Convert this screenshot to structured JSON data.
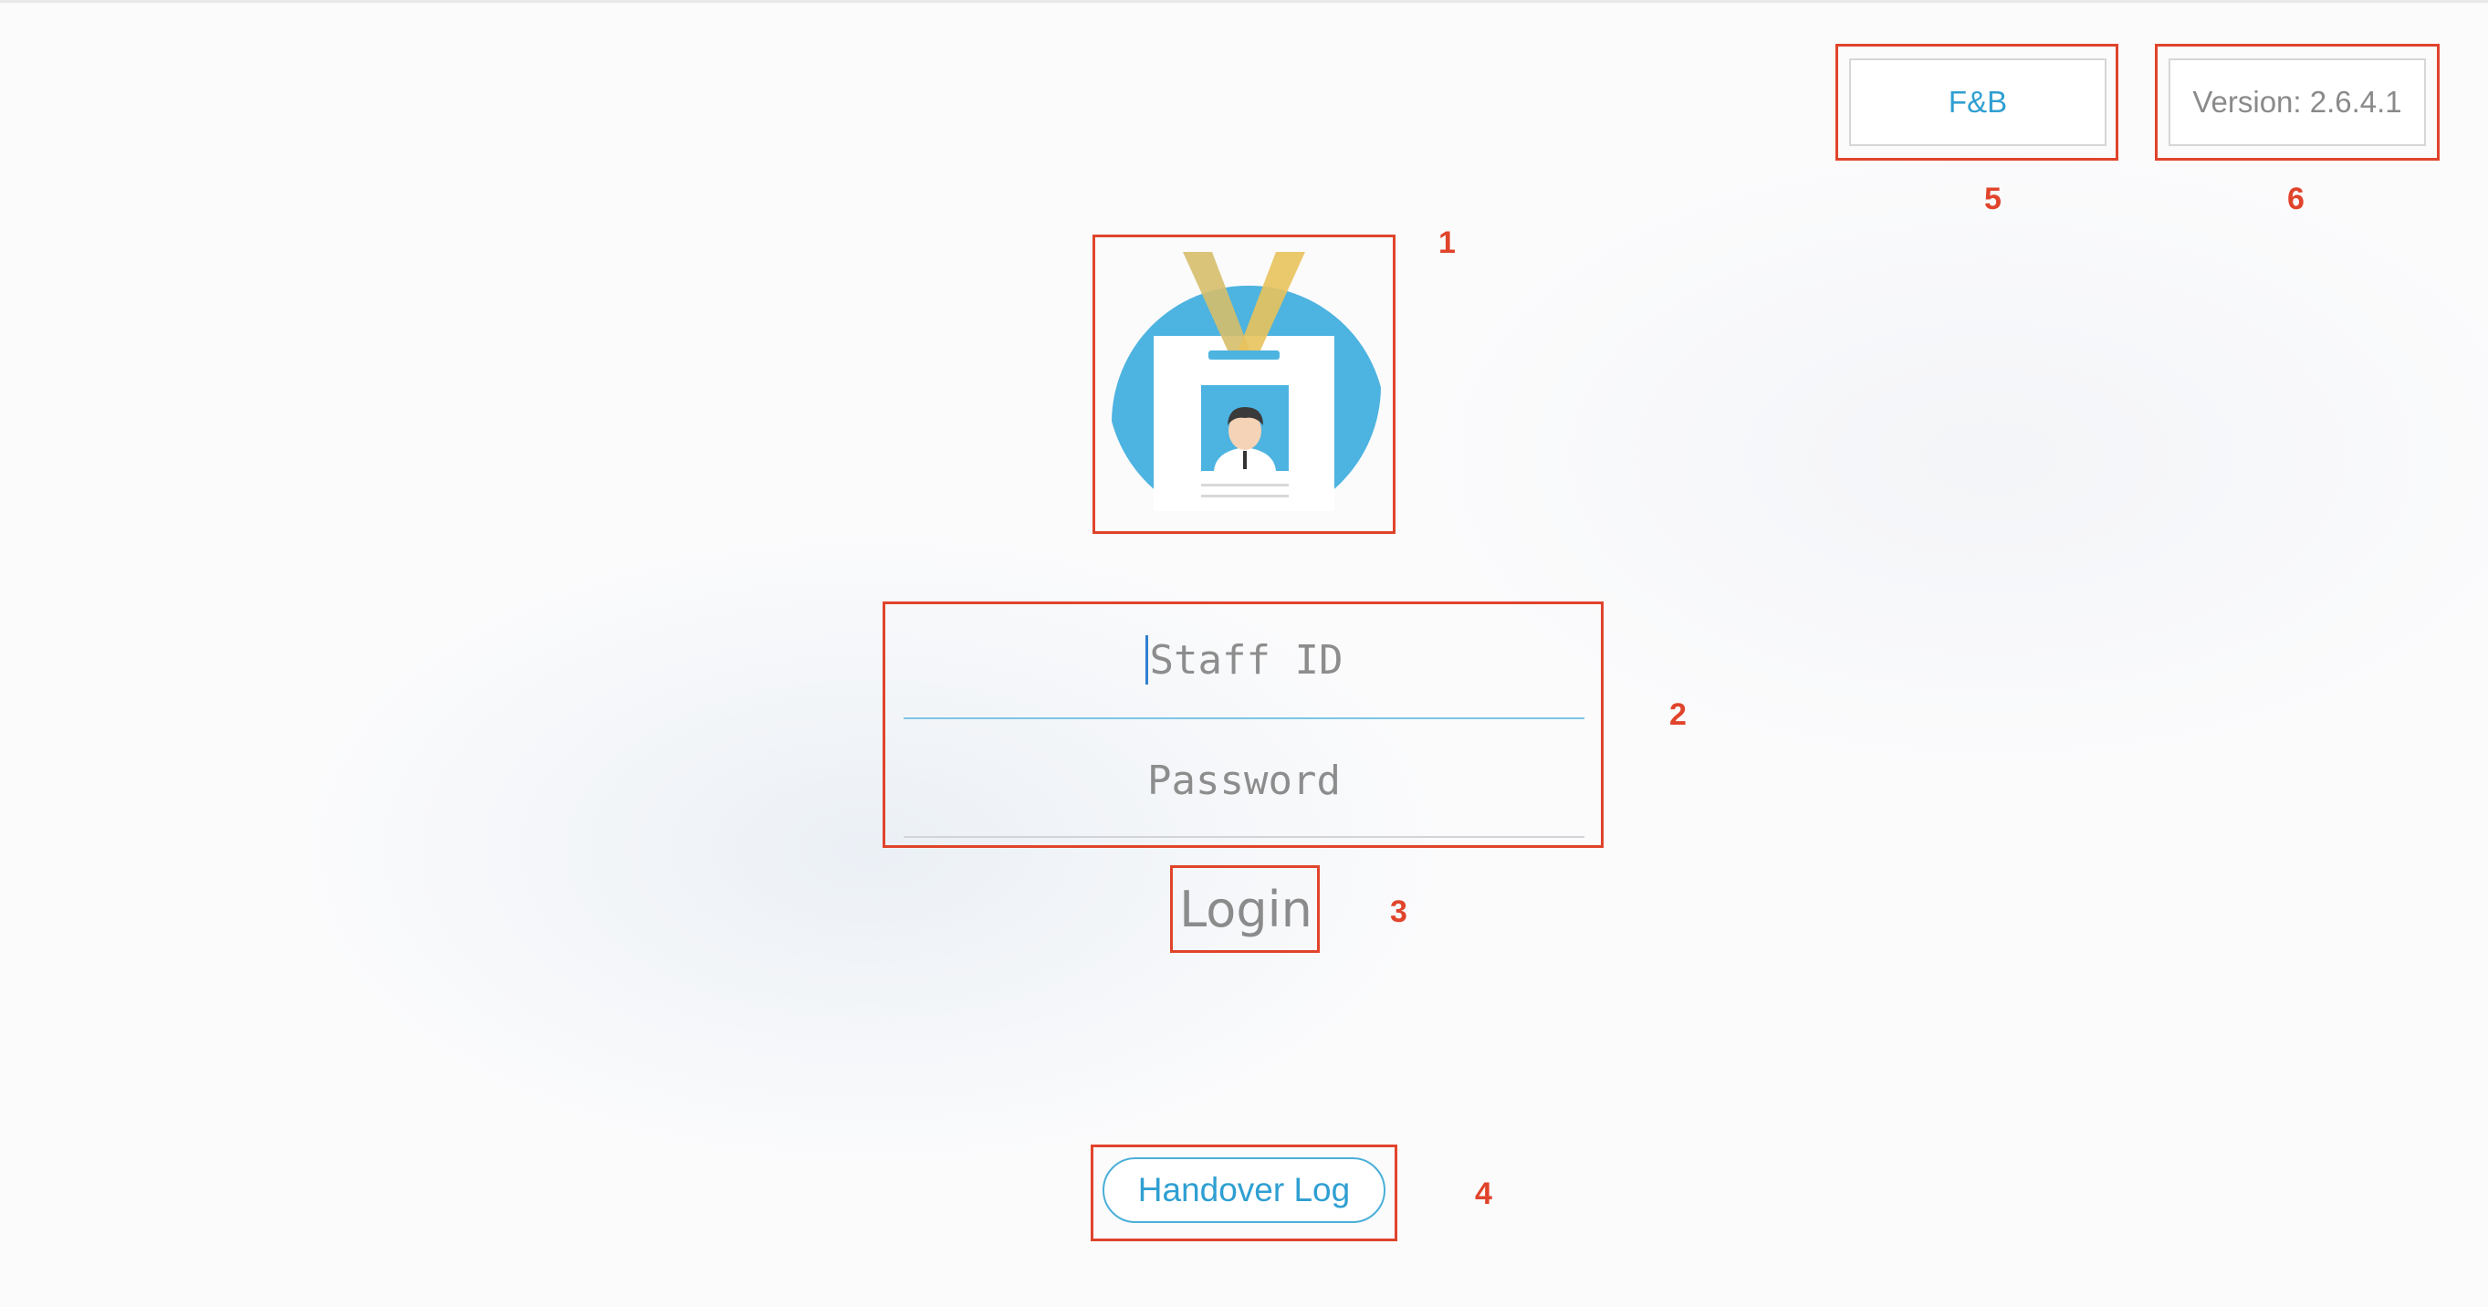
{
  "header": {
    "module_label": "F&B",
    "version_label": "Version: 2.6.4.1"
  },
  "login_form": {
    "staff_id_placeholder": "Staff ID",
    "password_placeholder": "Password",
    "login_label": "Login"
  },
  "footer": {
    "handover_log_label": "Handover Log"
  },
  "annotations": {
    "logo": "1",
    "credential_fields": "2",
    "login_button": "3",
    "handover_log": "4",
    "module_button": "5",
    "version_label": "6"
  },
  "colors": {
    "accent_blue": "#2f9fd2",
    "badge_blue": "#4db3e0",
    "lanyard_yellow": "#e8c25c",
    "annotation_red": "#e0442b"
  }
}
